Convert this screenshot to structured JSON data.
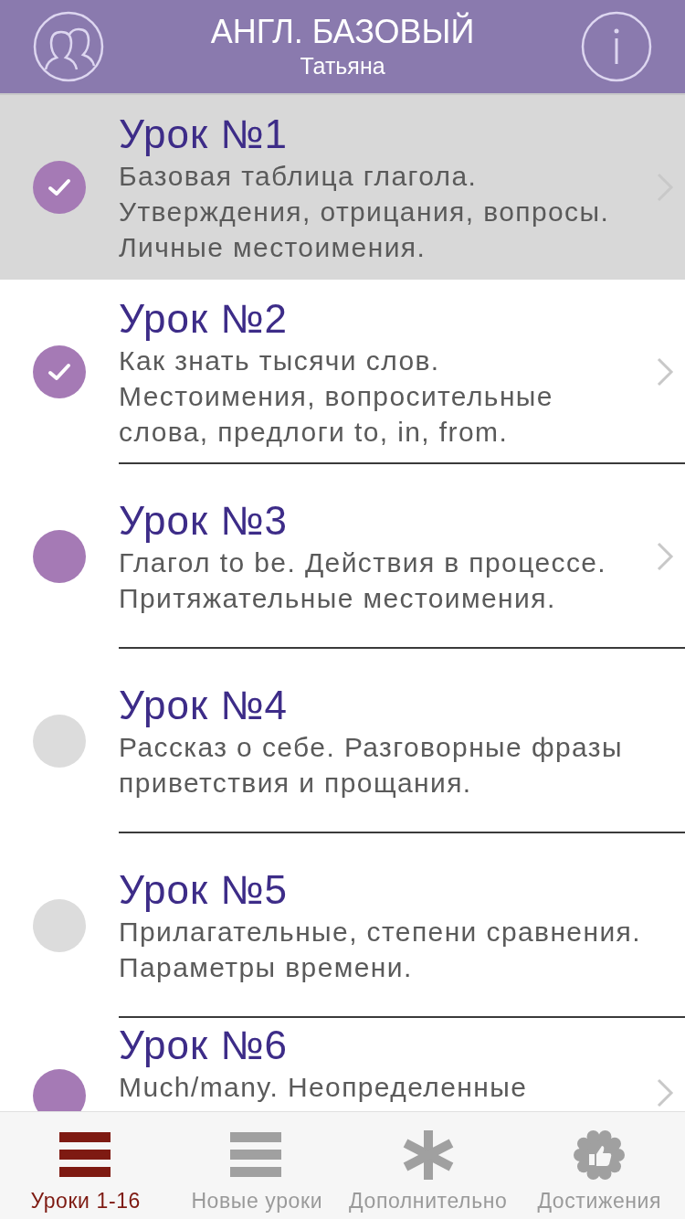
{
  "header": {
    "title": "АНГЛ. БАЗОВЫЙ",
    "subtitle": "Татьяна"
  },
  "lessons": [
    {
      "title": "Урок №1",
      "description": "Базовая таблица глагола. Утверждения, отрицания, вопросы. Личные местоимения.",
      "kind": "done",
      "selected": true
    },
    {
      "title": "Урок №2",
      "description": "Как знать тысячи слов. Местоимения, вопросительные слова, предлоги  to, in, from.",
      "kind": "done",
      "selected": false
    },
    {
      "title": "Урок №3",
      "description": "Глагол to be. Действия в процессе. Притяжательные местоимения.",
      "kind": "open",
      "selected": false
    },
    {
      "title": "Урок №4",
      "description": "Рассказ о себе. Разговорные фразы приветствия и прощания.",
      "kind": "locked",
      "selected": false
    },
    {
      "title": "Урок №5",
      "description": "Прилагательные, степени сравнения. Параметры времени.",
      "kind": "locked",
      "selected": false
    },
    {
      "title": "Урок №6",
      "description": "Much/many. Неопределенные",
      "kind": "open",
      "selected": false
    }
  ],
  "tabs": [
    {
      "label": "Уроки 1-16",
      "kind": "bars",
      "selected": true
    },
    {
      "label": "Новые уроки",
      "kind": "bars",
      "selected": false
    },
    {
      "label": "Дополнительно",
      "kind": "asterisk",
      "selected": false
    },
    {
      "label": "Достижения",
      "kind": "badge",
      "selected": false
    }
  ]
}
